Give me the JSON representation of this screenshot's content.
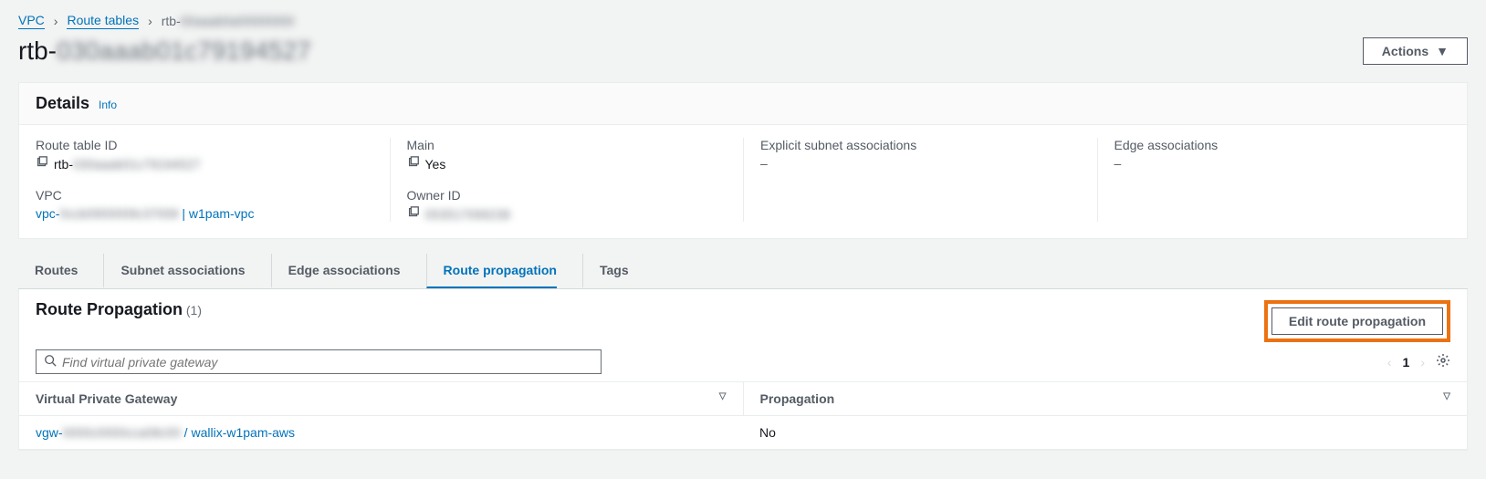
{
  "breadcrumb": {
    "vpc": "VPC",
    "route_tables": "Route tables",
    "current_prefix": "rtb-",
    "current_hidden": "00aaab0a00000000"
  },
  "page_title_prefix": "rtb-",
  "page_title_hidden": "030aaab01c79194527",
  "toolbar": {
    "actions": "Actions"
  },
  "details_panel": {
    "title": "Details",
    "info": "Info",
    "route_table_id_label": "Route table ID",
    "route_table_id_prefix": "rtb-",
    "route_table_id_hidden": "030aaab01c79194527",
    "vpc_label": "VPC",
    "vpc_prefix": "vpc-",
    "vpc_hidden": "0ccb0900009c37008",
    "vpc_suffix": " | w1pam-vpc",
    "main_label": "Main",
    "main_value": "Yes",
    "owner_label": "Owner ID",
    "owner_hidden": "053517099238",
    "explicit_label": "Explicit subnet associations",
    "explicit_value": "–",
    "edge_label": "Edge associations",
    "edge_value": "–"
  },
  "tabs": {
    "routes": "Routes",
    "subnet": "Subnet associations",
    "edge": "Edge associations",
    "propagation": "Route propagation",
    "tags": "Tags"
  },
  "propagation": {
    "title": "Route Propagation",
    "count": "(1)",
    "edit": "Edit route propagation",
    "search_placeholder": "Find virtual private gateway",
    "page": "1",
    "col_vgw": "Virtual Private Gateway",
    "col_prop": "Propagation",
    "row_prefix": "vgw-",
    "row_hidden": "0000c0000cca08c00",
    "row_suffix": " / wallix-w1pam-aws",
    "row_prop": "No"
  }
}
